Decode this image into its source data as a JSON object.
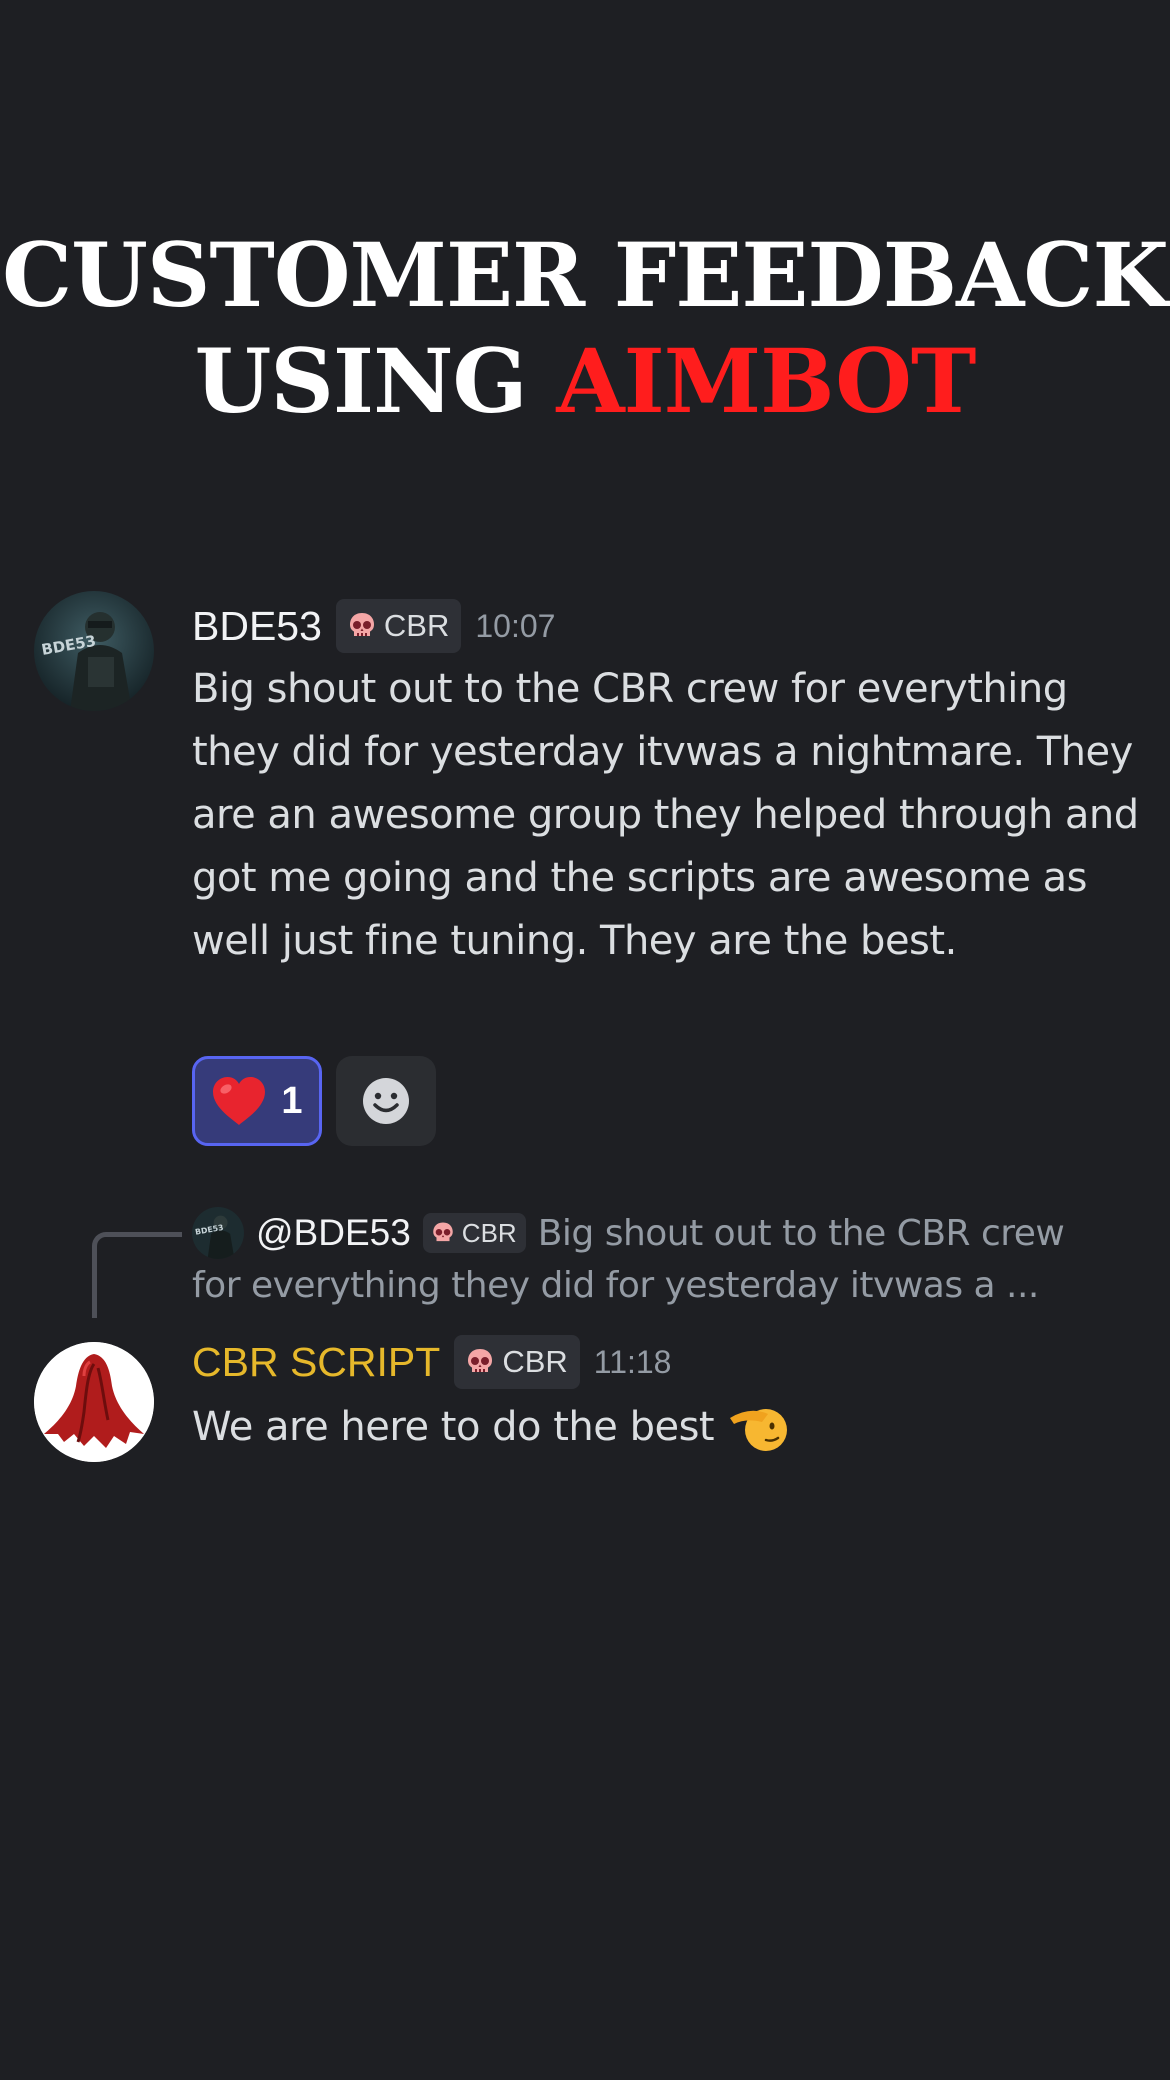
{
  "headline": {
    "line1": "CUSTOMER FEEDBACK",
    "line2_prefix": "USING ",
    "line2_accent": "AIMBOT"
  },
  "messages": [
    {
      "author": "BDE53",
      "avatar_icon": "soldier-avatar",
      "tag_icon": "skull-icon",
      "tag": "CBR",
      "time": "10:07",
      "text": "Big shout out to the CBR crew for everything they did for yesterday itvwas a nightmare. They are an awesome group they helped through and got me going and the scripts are awesome as well just fine tuning. They are the best.",
      "reactions": [
        {
          "icon": "red-heart-emoji",
          "count": "1",
          "active": true
        }
      ]
    },
    {
      "reply_to": {
        "author": "@BDE53",
        "tag": "CBR",
        "preview_line1": "Big shout out to the CBR crew",
        "preview_line2": "for everything they did for yesterday itvwas a ..."
      },
      "author": "CBR SCRIPT",
      "avatar_icon": "red-cloak-avatar",
      "tag_icon": "skull-icon",
      "tag": "CBR",
      "time": "11:18",
      "text": "We are here to do the best",
      "trailing_emoji": "saluting-face-emoji"
    }
  ],
  "colors": {
    "background": "#1e1f23",
    "accent_red": "#ff1d1d",
    "author_gold": "#e6b82b",
    "reaction_active": "#363b7a"
  }
}
